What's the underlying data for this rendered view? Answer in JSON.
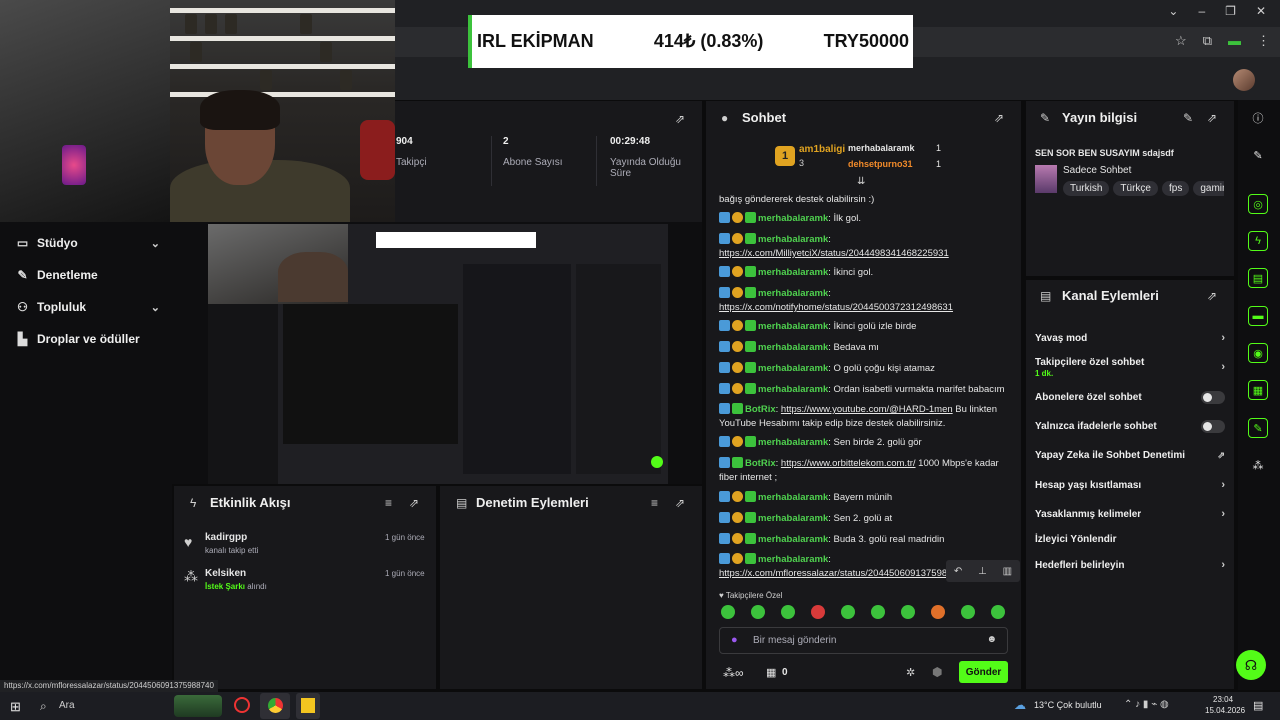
{
  "ticker": {
    "label": "IRL EKİPMAN",
    "amount": "414₺ (0.83%)",
    "goal": "TRY50000"
  },
  "sidebar": {
    "items": [
      {
        "label": "Stüdyo",
        "has_chevron": true
      },
      {
        "label": "Denetleme",
        "has_chevron": false
      },
      {
        "label": "Topluluk",
        "has_chevron": true
      },
      {
        "label": "Droplar ve ödüller",
        "has_chevron": false
      }
    ]
  },
  "stats": [
    {
      "value": "904",
      "label": "Takipçi"
    },
    {
      "value": "2",
      "label": "Abone Sayısı"
    },
    {
      "value": "00:29:48",
      "label": "Yayında Olduğu Süre"
    }
  ],
  "chat": {
    "title": "Sohbet",
    "top_gifters": [
      {
        "name": "am1baligi",
        "count": "3"
      },
      {
        "name": "merhabalaramk",
        "count": "1"
      },
      {
        "name": "dehsetpurno31",
        "count": "1"
      }
    ],
    "partial_line": "bağış göndererek destek olabilirsin :)",
    "messages": [
      {
        "user": "merhabalaramk",
        "text": "İlk gol.",
        "link": ""
      },
      {
        "user": "merhabalaramk",
        "text": "",
        "link": "https://x.com/MilliyetciX/status/2044498341468225931"
      },
      {
        "user": "merhabalaramk",
        "text": "İkinci gol.",
        "link": ""
      },
      {
        "user": "merhabalaramk",
        "text": "",
        "link": "https://x.com/notifyhome/status/2044500372312498631"
      },
      {
        "user": "merhabalaramk",
        "text": "İkinci golü izle birde",
        "link": ""
      },
      {
        "user": "merhabalaramk",
        "text": "Bedava mı",
        "link": ""
      },
      {
        "user": "merhabalaramk",
        "text": "O golü çoğu kişi atamaz",
        "link": ""
      },
      {
        "user": "merhabalaramk",
        "text": "Ordan isabetli vurmakta marifet babacım",
        "link": ""
      },
      {
        "user": "BotRix",
        "text": "Bu linkten YouTube Hesabımı takip edip bize destek olabilirsiniz.",
        "link": "https://www.youtube.com/@HARD-1men"
      },
      {
        "user": "merhabalaramk",
        "text": "Sen birde 2. golü gör",
        "link": ""
      },
      {
        "user": "BotRix",
        "text": "1000 Mbps'e kadar fiber internet ;",
        "link": "https://www.orbittelekom.com.tr/"
      },
      {
        "user": "merhabalaramk",
        "text": "Bayern münih",
        "link": ""
      },
      {
        "user": "merhabalaramk",
        "text": "Sen 2. golü at",
        "link": ""
      },
      {
        "user": "merhabalaramk",
        "text": "Buda 3. golü real madridin",
        "link": ""
      },
      {
        "user": "merhabalaramk",
        "text": "",
        "link": "https://x.com/mfloressalazar/status/2044506091375988"
      }
    ],
    "followers_only": "Takipçilere Özel",
    "input_placeholder": "Bir mesaj gönderin",
    "points": "0",
    "send_label": "Gönder"
  },
  "stream_info": {
    "title": "Yayın bilgisi",
    "stream_title": "SEN SOR BEN SUSAYIM sdajsdf",
    "category": "Sadece Sohbet",
    "tags": [
      "Turkish",
      "Türkçe",
      "fps",
      "gaming"
    ]
  },
  "channel_actions": {
    "title": "Kanal Eylemleri",
    "slow_mode": "Yavaş mod",
    "followers_chat": "Takipçilere özel sohbet",
    "followers_chat_sub": "1 dk.",
    "subs_chat": "Abonelere özel sohbet",
    "emote_chat": "Yalnızca ifadelerle sohbet",
    "ai_mod": "Yapay Zeka ile Sohbet Denetimi",
    "age_limit": "Hesap yaşı kısıtlaması",
    "banned_words": "Yasaklanmış kelimeler",
    "redirect": "İzleyici Yönlendir",
    "goals": "Hedefleri belirleyin"
  },
  "activity": {
    "title": "Etkinlik Akışı",
    "events": [
      {
        "user": "kadirgpp",
        "desc": "kanalı takip etti",
        "highlight": "",
        "time": "1 gün önce"
      },
      {
        "user": "Kelsiken",
        "desc": "alındı",
        "highlight": "İstek Şarkı",
        "time": "1 gün önce"
      }
    ]
  },
  "moderation": {
    "title": "Denetim Eylemleri"
  },
  "status_url": "https://x.com/mfloressalazar/status/2044506091375988740",
  "taskbar": {
    "search": "Ara",
    "weather": "13°C  Çok bulutlu",
    "time": "23:04",
    "date": "15.04.2026"
  },
  "colors": {
    "accent": "#53fc18",
    "panel": "#18181b",
    "bg": "#0e0e10"
  }
}
